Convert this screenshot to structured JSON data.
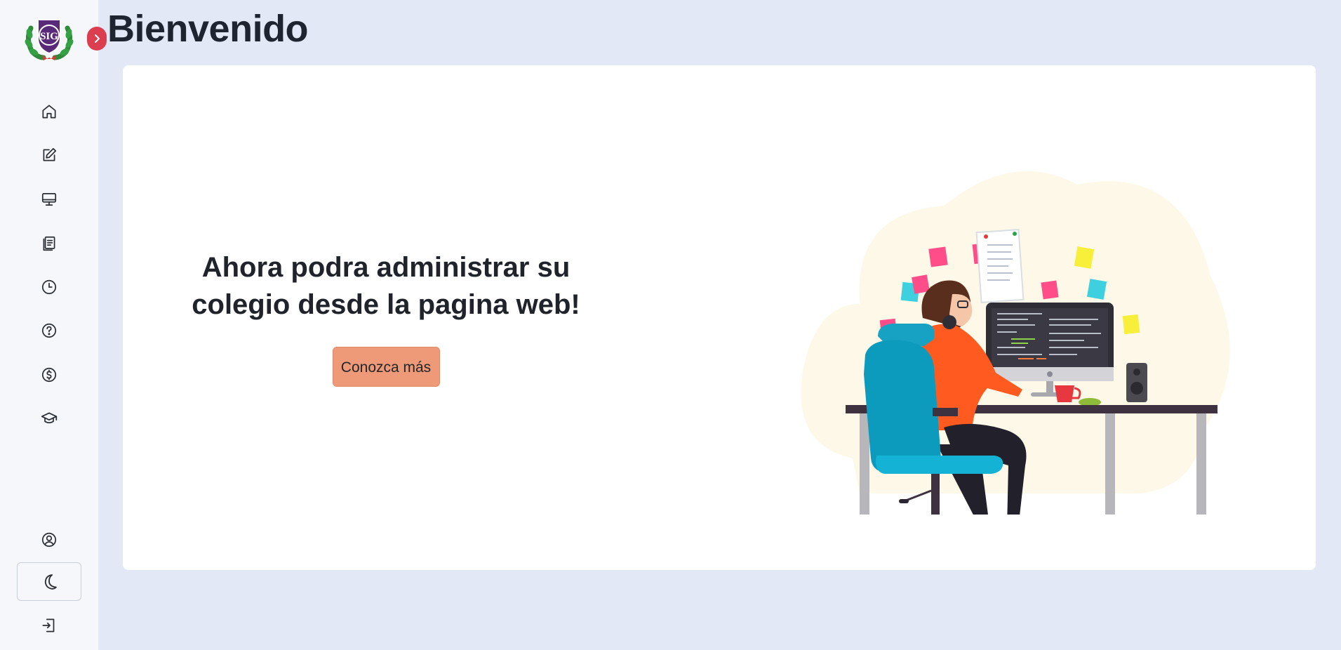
{
  "header": {
    "title": "Bienvenido"
  },
  "sidebar": {
    "logo": {
      "icon": "school-crest-logo",
      "text": "SIG"
    },
    "toggle_icon": "chevron-right-icon",
    "toggle_color": "#db3e4f",
    "items": [
      {
        "icon": "home-icon"
      },
      {
        "icon": "edit-icon"
      },
      {
        "icon": "monitor-icon"
      },
      {
        "icon": "clipboard-icon"
      },
      {
        "icon": "clock-icon"
      },
      {
        "icon": "help-circle-icon"
      },
      {
        "icon": "dollar-circle-icon"
      },
      {
        "icon": "graduation-cap-icon"
      }
    ],
    "bottom_items": [
      {
        "icon": "user-circle-icon"
      },
      {
        "icon": "moon-icon"
      },
      {
        "icon": "logout-icon"
      }
    ]
  },
  "main": {
    "hero_text": "Ahora podra administrar su colegio desde la pagina web!",
    "cta_label": "Conozca más",
    "cta_color": "#ee9a78",
    "illustration": "person-working-at-computer-illustration"
  }
}
